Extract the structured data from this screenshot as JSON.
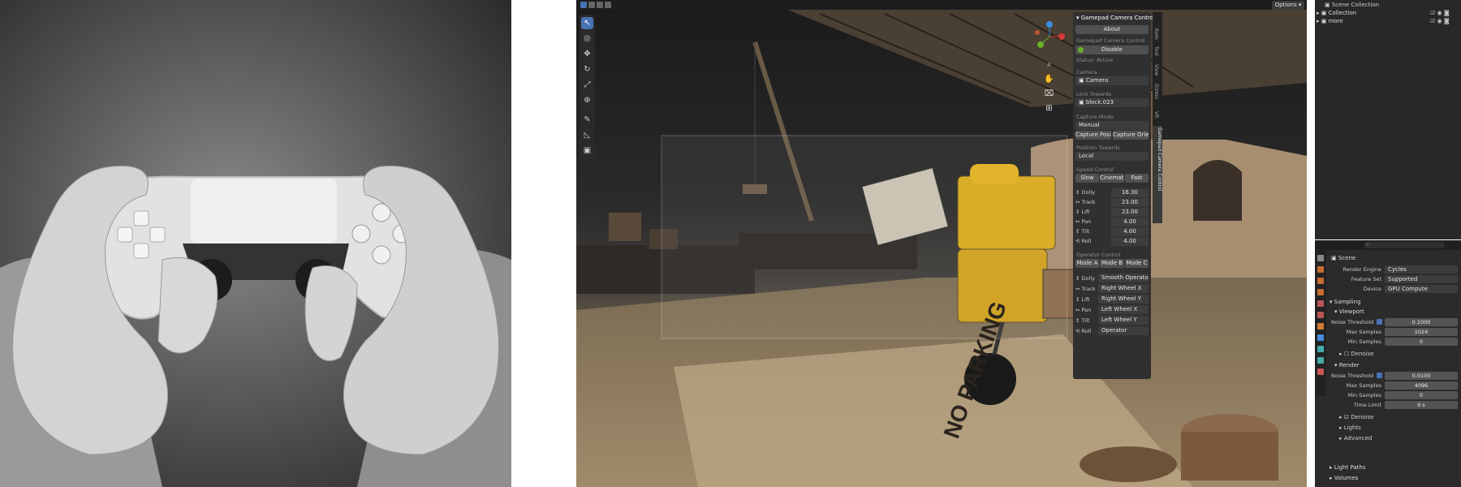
{
  "header": {
    "options_label": "Options"
  },
  "panel": {
    "title": "Gamepad Camera Control",
    "about": "About",
    "control_label": "Gamepad Camera Control",
    "disable": "Disable",
    "status": "Status: Active",
    "camera_label": "Camera",
    "camera_value": "Camera",
    "lock_label": "Lock Towards",
    "lock_value": "block.023",
    "capture_label": "Capture Mode",
    "capture_value": "Manual",
    "capture_pos": "Capture Posit...",
    "capture_ori": "Capture Orien...",
    "position_label": "Position Towards",
    "position_value": "Local",
    "speed_label": "Speed Control",
    "speed_buttons": [
      "Slow",
      "Cinematic",
      "Fast"
    ],
    "speeds": [
      {
        "icon": "↕",
        "name": "Dolly",
        "value": "16.30"
      },
      {
        "icon": "↔",
        "name": "Track",
        "value": "23.00"
      },
      {
        "icon": "↕",
        "name": "Lift",
        "value": "23.00"
      },
      {
        "icon": "↔",
        "name": "Pan",
        "value": "4.00"
      },
      {
        "icon": "↕",
        "name": "Tilt",
        "value": "4.00"
      },
      {
        "icon": "⟲",
        "name": "Roll",
        "value": "4.00"
      }
    ],
    "operator_label": "Operator Control",
    "modes": [
      "Mode A",
      "Mode B",
      "Mode C"
    ],
    "operators": [
      {
        "icon": "↕",
        "name": "Dolly",
        "value": "Smooth Operator"
      },
      {
        "icon": "↔",
        "name": "Track",
        "value": "Right Wheel X"
      },
      {
        "icon": "↕",
        "name": "Lift",
        "value": "Right Wheel Y"
      },
      {
        "icon": "↔",
        "name": "Pan",
        "value": "Left Wheel X"
      },
      {
        "icon": "↕",
        "name": "Tilt",
        "value": "Left Wheel Y"
      },
      {
        "icon": "⟲",
        "name": "Roll",
        "value": "Operator"
      }
    ]
  },
  "ntabs": [
    "Item",
    "Tool",
    "View",
    "Gizmo",
    "VR",
    "Gamepad Camera Control"
  ],
  "outliner": {
    "root": "Scene Collection",
    "items": [
      {
        "label": "Collection"
      },
      {
        "label": "more"
      }
    ]
  },
  "properties": {
    "scene": "Scene",
    "render_engine_label": "Render Engine",
    "render_engine": "Cycles",
    "feature_set_label": "Feature Set",
    "feature_set": "Supported",
    "device_label": "Device",
    "device": "GPU Compute",
    "sampling": "Sampling",
    "viewport": "Viewport",
    "vp_noise_label": "Noise Threshold",
    "vp_noise": "0.1000",
    "vp_max_label": "Max Samples",
    "vp_max": "1024",
    "vp_min_label": "Min Samples",
    "vp_min": "0",
    "denoise": "Denoise",
    "render": "Render",
    "r_noise_label": "Noise Threshold",
    "r_noise": "0.0100",
    "r_max_label": "Max Samples",
    "r_max": "4096",
    "r_min_label": "Min Samples",
    "r_min": "0",
    "r_time_label": "Time Limit",
    "r_time": "0 s",
    "denoise2": "Denoise",
    "lights": "Lights",
    "advanced": "Advanced",
    "light_paths": "Light Paths",
    "volumes": "Volumes"
  },
  "scene_text": "NO PARKING",
  "colors": {
    "accent": "#4772b3",
    "panel": "#303030",
    "header": "#1d1d1d",
    "robot": "#d8a91e"
  }
}
